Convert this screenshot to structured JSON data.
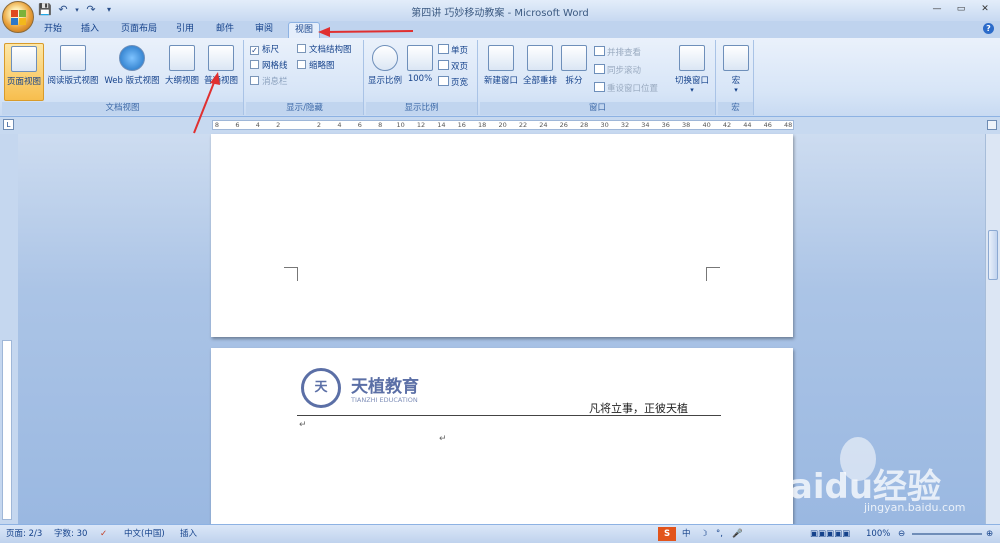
{
  "window": {
    "title": "第四讲 巧妙移动教案 - Microsoft Word",
    "controls": [
      "—",
      "▭",
      "✕"
    ]
  },
  "quick_access": [
    "save",
    "undo",
    "redo",
    "customize"
  ],
  "tabs": [
    {
      "label": "开始",
      "active": false
    },
    {
      "label": "插入",
      "active": false
    },
    {
      "label": "页面布局",
      "active": false
    },
    {
      "label": "引用",
      "active": false
    },
    {
      "label": "邮件",
      "active": false
    },
    {
      "label": "审阅",
      "active": false
    },
    {
      "label": "视图",
      "active": true
    }
  ],
  "ribbon": {
    "doc_views": {
      "label": "文档视图",
      "buttons": [
        "页面视图",
        "阅读版式视图",
        "Web 版式视图",
        "大纲视图",
        "普通视图"
      ]
    },
    "show_hide": {
      "label": "显示/隐藏",
      "checks": [
        {
          "label": "标尺",
          "checked": true,
          "disabled": false
        },
        {
          "label": "文档结构图",
          "checked": false,
          "disabled": false
        },
        {
          "label": "网格线",
          "checked": false,
          "disabled": false
        },
        {
          "label": "缩略图",
          "checked": false,
          "disabled": false
        },
        {
          "label": "消息栏",
          "checked": false,
          "disabled": true
        }
      ]
    },
    "zoom": {
      "label": "显示比例",
      "big": [
        "显示比例",
        "100%"
      ],
      "small": [
        "单页",
        "双页",
        "页宽"
      ]
    },
    "window": {
      "label": "窗口",
      "big": [
        "新建窗口",
        "全部重排",
        "拆分"
      ],
      "small": [
        "并排查看",
        "同步滚动",
        "重设窗口位置"
      ],
      "switch": "切换窗口"
    },
    "macros": {
      "label": "宏",
      "button": "宏"
    }
  },
  "ruler_ticks": [
    "8",
    "6",
    "4",
    "2",
    "",
    "2",
    "4",
    "6",
    "8",
    "10",
    "12",
    "14",
    "16",
    "18",
    "20",
    "22",
    "24",
    "26",
    "28",
    "30",
    "32",
    "34",
    "36",
    "38",
    "40",
    "42",
    "44",
    "46",
    "48"
  ],
  "page2": {
    "logo_cn": "天植教育",
    "logo_en": "TIANZHI EDUCATION",
    "header_text": "凡将立事，正彼天植",
    "para_mark": "↵"
  },
  "status": {
    "page": "页面: 2/3",
    "words": "字数: 30",
    "lang": "中文(中国)",
    "mode": "插入",
    "zoom": "100%"
  },
  "watermark": {
    "brand": "Baidu经验",
    "url": "jingyan.baidu.com"
  },
  "colors": {
    "ribbon": "#dbe6f6",
    "accent_tab": "#e5eefb",
    "selected_button": "#f7be4e",
    "arrow": "#e03030"
  }
}
